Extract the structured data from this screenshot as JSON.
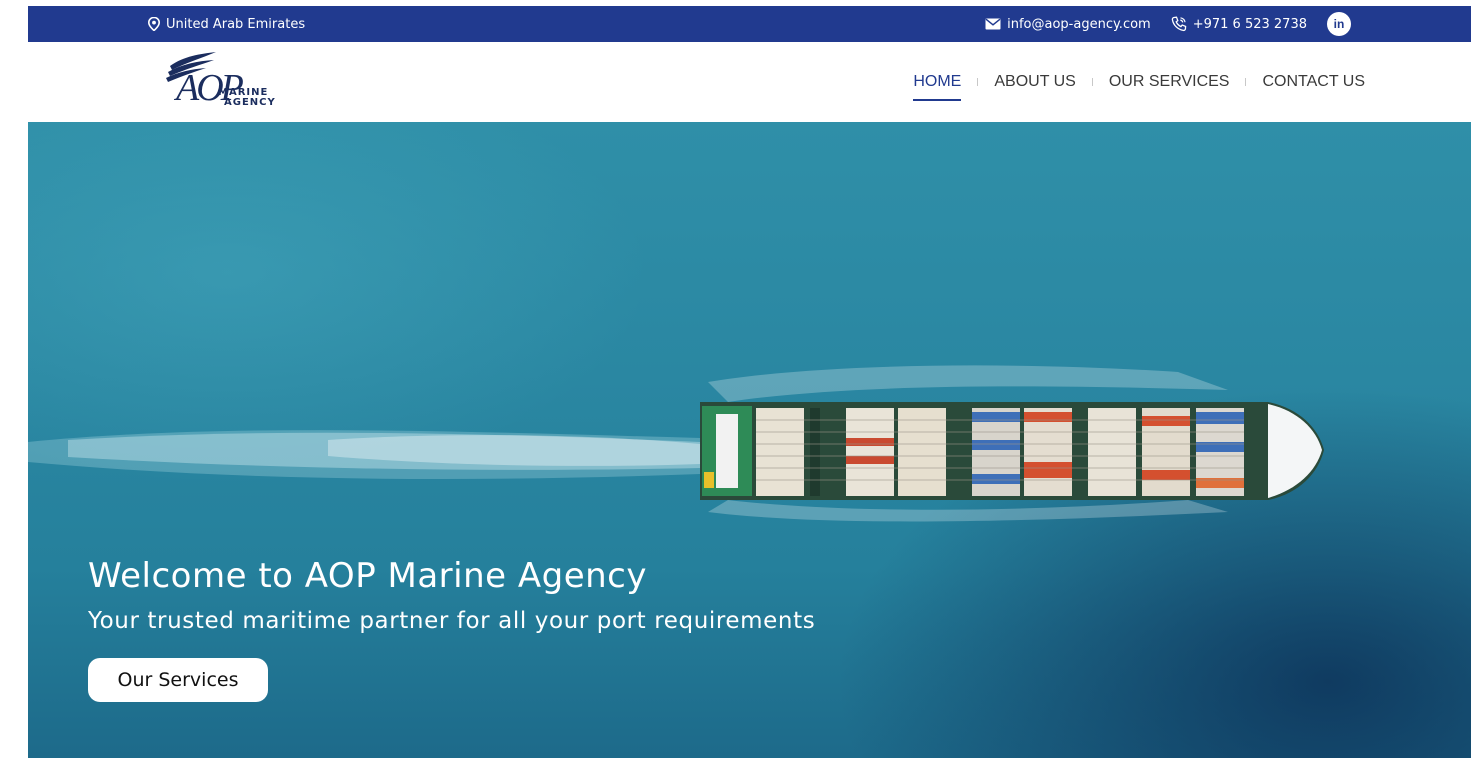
{
  "topbar": {
    "location": "United Arab Emirates",
    "email": "info@aop-agency.com",
    "phone": "+971 6 523 2738",
    "social_label": "in"
  },
  "logo": {
    "brand": "AOP",
    "line1": "MARINE",
    "line2": "AGENCY"
  },
  "nav": {
    "items": [
      {
        "label": "HOME",
        "active": true
      },
      {
        "label": "ABOUT US",
        "active": false
      },
      {
        "label": "OUR SERVICES",
        "active": false
      },
      {
        "label": "CONTACT US",
        "active": false
      }
    ]
  },
  "hero": {
    "title": "Welcome to AOP Marine Agency",
    "subtitle": "Your trusted maritime partner for all your port requirements",
    "button_label": "Our Services"
  },
  "colors": {
    "primary": "#213a8f",
    "sea": "#2a87a2",
    "logo": "#1b2d5e"
  },
  "icons": {
    "location": "map-pin-icon",
    "email": "envelope-icon",
    "phone": "phone-icon",
    "social": "linkedin-icon"
  }
}
